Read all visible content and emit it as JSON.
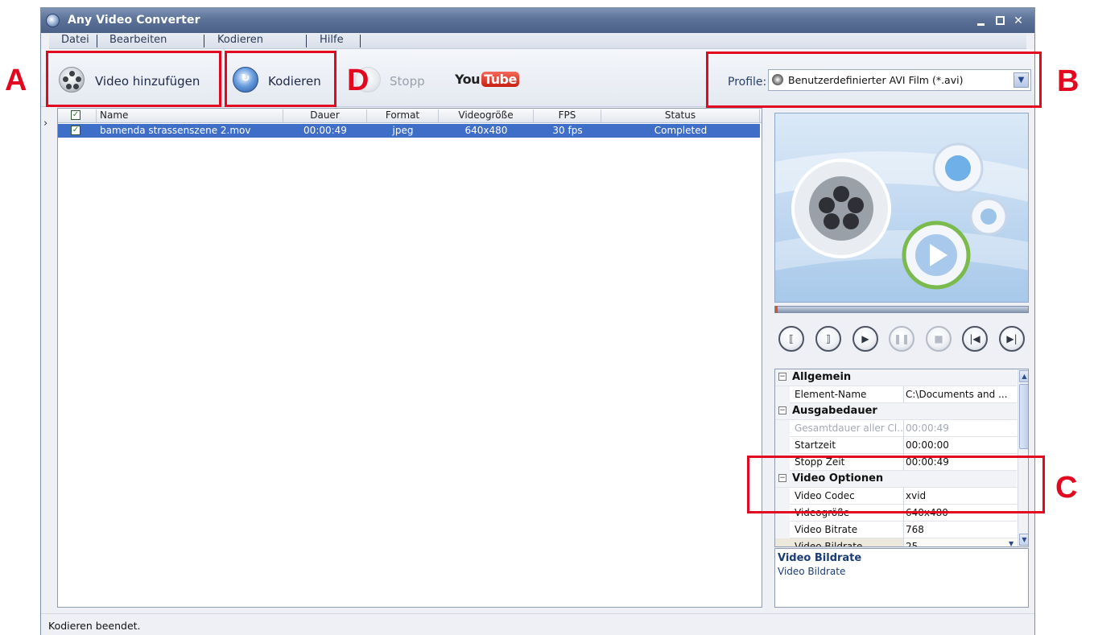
{
  "window": {
    "title": "Any Video Converter"
  },
  "menu": [
    "Datei",
    "Bearbeiten",
    "Kodieren",
    "Hilfe"
  ],
  "toolbar": {
    "add_label": "Video hinzufügen",
    "convert_label": "Kodieren",
    "stop_label": "Stopp",
    "youtube_you": "You",
    "youtube_tube": "Tube",
    "profile_label": "Profile:",
    "profile_value": "Benutzerdefinierter AVI Film (*.avi)"
  },
  "filelist": {
    "columns": [
      "Name",
      "Dauer",
      "Format",
      "Videogröße",
      "FPS",
      "Status"
    ],
    "rows": [
      {
        "checked": true,
        "name": "bamenda strassenszene 2.mov",
        "dauer": "00:00:49",
        "format": "jpeg",
        "size": "640x480",
        "fps": "30 fps",
        "status": "Completed"
      }
    ]
  },
  "properties": {
    "general": {
      "title": "Allgemein",
      "element_name_label": "Element-Name",
      "element_name_value": "C:\\Documents and ..."
    },
    "duration": {
      "title": "Ausgabedauer",
      "total_label": "Gesamtdauer aller Cl...",
      "total_value": "00:00:49",
      "start_label": "Startzeit",
      "start_value": "00:00:00",
      "stop_label": "Stopp Zeit",
      "stop_value": "00:00:49"
    },
    "video": {
      "title": "Video Optionen",
      "codec_label": "Video Codec",
      "codec_value": "xvid",
      "size_label": "Videogröße",
      "size_value": "640x480",
      "bitrate_label": "Video Bitrate",
      "bitrate_value": "768",
      "framerate_label": "Video Bildrate",
      "framerate_value": "25"
    }
  },
  "description": {
    "title": "Video Bildrate",
    "text": "Video Bildrate"
  },
  "status_bar": "Kodieren beendet.",
  "annotations": {
    "A": "A",
    "B": "B",
    "C": "C",
    "D": "D"
  },
  "colors": {
    "annotation_red": "#e2081f",
    "selection_blue": "#3e6ec8",
    "title_blue": "#4c6188"
  }
}
